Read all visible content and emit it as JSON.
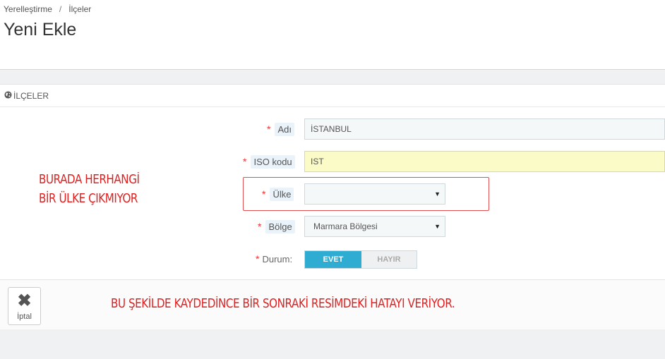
{
  "breadcrumb": {
    "item1": "Yerelleştirme",
    "separator": "/",
    "item2": "İlçeler"
  },
  "page_title": "Yeni Ekle",
  "panel": {
    "heading": "İLÇELER",
    "heading_icon": "globe-icon"
  },
  "form": {
    "name": {
      "label": "Adı",
      "required": "*",
      "value": "İSTANBUL"
    },
    "iso": {
      "label": "ISO kodu",
      "required": "*",
      "value": "IST"
    },
    "country": {
      "label": "Ülke",
      "required": "*",
      "value": ""
    },
    "region": {
      "label": "Bölge",
      "required": "*",
      "value": "Marmara Bölgesi"
    },
    "status": {
      "label": "Durum:",
      "required": "*",
      "yes": "EVET",
      "no": "HAYIR",
      "selected": "EVET"
    },
    "caret": "▼"
  },
  "annotations": {
    "note1_line1": "BURADA HERHANGİ",
    "note1_line2": "BİR ÜLKE ÇIKMIYOR",
    "note2": "BU ŞEKİLDE KAYDEDİNCE BİR SONRAKİ RESİMDEKİ HATAYI VERİYOR."
  },
  "footer": {
    "cancel_label": "İptal",
    "cancel_icon": "close-icon"
  },
  "colors": {
    "accent": "#2eacd2",
    "required": "#e33333",
    "annotation": "#e21f1f",
    "iso_highlight": "#fbfbc8"
  }
}
